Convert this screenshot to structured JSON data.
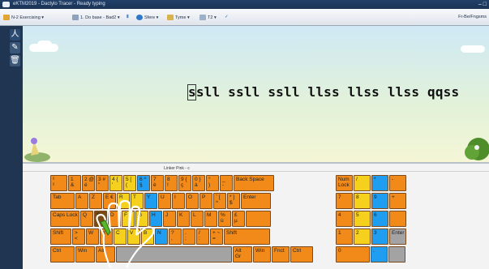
{
  "window": {
    "title": "eKTM2019 - Dactylo Tracer - Ready typing",
    "controls": "– □"
  },
  "toolbar": {
    "items": [
      "N-2 Exercising ▾",
      "1. Do base - Bad2 ▾",
      "Ⅱ",
      "Sfere ▾",
      "Tyme ▾",
      "T2 ▾",
      "✓"
    ],
    "right": "Fr-Be/Fngsms"
  },
  "sidebar": {
    "buttons": [
      {
        "name": "typist-icon",
        "glyph": "人"
      },
      {
        "name": "pencil-icon",
        "glyph": "✎"
      },
      {
        "name": "trash-icon",
        "glyph": "🗑"
      }
    ]
  },
  "lesson": {
    "current_char": "s",
    "text": "sll ssll ssll llss llss llss qqss"
  },
  "keyboard": {
    "title": "Linker Pink - c",
    "rows": [
      [
        {
          "t": "²\n²",
          "c": "o",
          "w": 21
        },
        {
          "t": "1\n&",
          "c": "o",
          "w": 16
        },
        {
          "t": "2 @\né",
          "c": "o",
          "w": 16
        },
        {
          "t": "3 #\n\"",
          "c": "o",
          "w": 16
        },
        {
          "t": "4 {\n'",
          "c": "y",
          "w": 16
        },
        {
          "t": "5 [\n(",
          "c": "y",
          "w": 16
        },
        {
          "t": "6 ^\n§",
          "c": "b",
          "w": 16
        },
        {
          "t": "7\nè",
          "c": "o",
          "w": 16
        },
        {
          "t": "8\n!",
          "c": "o",
          "w": 16
        },
        {
          "t": "9 {\nç",
          "c": "o",
          "w": 16
        },
        {
          "t": "0 }\nà",
          "c": "o",
          "w": 16
        },
        {
          "t": "°\n)",
          "c": "o",
          "w": 16
        },
        {
          "t": "_\n-",
          "c": "o",
          "w": 16
        },
        {
          "t": "Back Space",
          "c": "o",
          "w": 50
        }
      ],
      [
        {
          "t": "Tab",
          "c": "o",
          "w": 30
        },
        {
          "t": "A",
          "c": "o",
          "w": 16
        },
        {
          "t": "Z",
          "c": "o",
          "w": 16
        },
        {
          "t": "E €",
          "c": "o",
          "w": 16
        },
        {
          "t": "R",
          "c": "y",
          "w": 16
        },
        {
          "t": "T",
          "c": "y",
          "w": 16
        },
        {
          "t": "Y",
          "c": "b",
          "w": 16
        },
        {
          "t": "U",
          "c": "o",
          "w": 16
        },
        {
          "t": "I",
          "c": "o",
          "w": 16
        },
        {
          "t": "O",
          "c": "o",
          "w": 16
        },
        {
          "t": "P",
          "c": "o",
          "w": 16
        },
        {
          "t": "¨ [\n^",
          "c": "o",
          "w": 16
        },
        {
          "t": "* ]\n$",
          "c": "o",
          "w": 16
        },
        {
          "t": "Enter",
          "c": "o",
          "w": 37
        }
      ],
      [
        {
          "t": "Caps Lock",
          "c": "o",
          "w": 36
        },
        {
          "t": "Q",
          "c": "o",
          "w": 16
        },
        {
          "t": "S",
          "c": "dk",
          "w": 16
        },
        {
          "t": "D",
          "c": "o",
          "w": 16
        },
        {
          "t": "F",
          "c": "y",
          "w": 16
        },
        {
          "t": "G",
          "c": "y",
          "w": 16
        },
        {
          "t": "H",
          "c": "b",
          "w": 16
        },
        {
          "t": "J",
          "c": "o",
          "w": 16
        },
        {
          "t": "K",
          "c": "o",
          "w": 16
        },
        {
          "t": "L",
          "c": "o",
          "w": 16
        },
        {
          "t": "M",
          "c": "o",
          "w": 16
        },
        {
          "t": "%\nù",
          "c": "o",
          "w": 16
        },
        {
          "t": "£\nµ",
          "c": "o",
          "w": 16
        },
        {
          "t": "",
          "c": "o",
          "w": 31
        }
      ],
      [
        {
          "t": "Shift",
          "c": "o",
          "w": 26
        },
        {
          "t": ">\n<",
          "c": "o",
          "w": 16
        },
        {
          "t": "W",
          "c": "o",
          "w": 16
        },
        {
          "t": "X",
          "c": "o",
          "w": 16
        },
        {
          "t": "C",
          "c": "y",
          "w": 16
        },
        {
          "t": "V",
          "c": "y",
          "w": 16
        },
        {
          "t": "B",
          "c": "y",
          "w": 16
        },
        {
          "t": "N",
          "c": "b",
          "w": 16
        },
        {
          "t": "?\n,",
          "c": "o",
          "w": 16
        },
        {
          "t": ".\n;",
          "c": "o",
          "w": 16
        },
        {
          "t": "/\n:",
          "c": "o",
          "w": 16
        },
        {
          "t": "+ ~\n=",
          "c": "o",
          "w": 16
        },
        {
          "t": "Shift",
          "c": "o",
          "w": 57
        }
      ],
      [
        {
          "t": "Ctrl",
          "c": "o",
          "w": 30
        },
        {
          "t": "Win",
          "c": "o",
          "w": 24
        },
        {
          "t": "Alt",
          "c": "o",
          "w": 24
        },
        {
          "t": "",
          "c": "gr",
          "w": 143
        },
        {
          "t": "Alt\nGr",
          "c": "o",
          "w": 24
        },
        {
          "t": "Win",
          "c": "o",
          "w": 22
        },
        {
          "t": "Fnct",
          "c": "o",
          "w": 22
        },
        {
          "t": "Ctrl",
          "c": "o",
          "w": 28
        }
      ]
    ],
    "numpad": [
      [
        {
          "t": "Num\nLock",
          "c": "o",
          "w": 21
        },
        {
          "t": "/",
          "c": "y",
          "w": 21
        },
        {
          "t": "*",
          "c": "b",
          "w": 21
        },
        {
          "t": "-",
          "c": "o",
          "w": 21
        }
      ],
      [
        {
          "t": "7",
          "c": "o",
          "w": 21
        },
        {
          "t": "8",
          "c": "y",
          "w": 21
        },
        {
          "t": "9",
          "c": "b",
          "w": 21
        },
        {
          "t": "+",
          "c": "o",
          "w": 21
        }
      ],
      [
        {
          "t": "4",
          "c": "o",
          "w": 21
        },
        {
          "t": "5",
          "c": "y",
          "w": 21
        },
        {
          "t": "6",
          "c": "b",
          "w": 21
        },
        {
          "t": "",
          "c": "o",
          "w": 21
        }
      ],
      [
        {
          "t": "1",
          "c": "o",
          "w": 21
        },
        {
          "t": "2",
          "c": "y",
          "w": 21
        },
        {
          "t": "3",
          "c": "b",
          "w": 21
        },
        {
          "t": "Enter",
          "c": "gr",
          "w": 21
        }
      ],
      [
        {
          "t": "0",
          "c": "o",
          "w": 42
        },
        {
          "t": ".",
          "c": "b",
          "w": 21
        },
        {
          "t": "",
          "c": "gr",
          "w": 21
        }
      ]
    ]
  },
  "colors": {
    "key_orange": "#f28a1a",
    "key_yellow": "#f5d11d",
    "key_blue": "#1f9df0",
    "key_active_brown": "#7a4a13",
    "finger_green": "#58b62c"
  }
}
